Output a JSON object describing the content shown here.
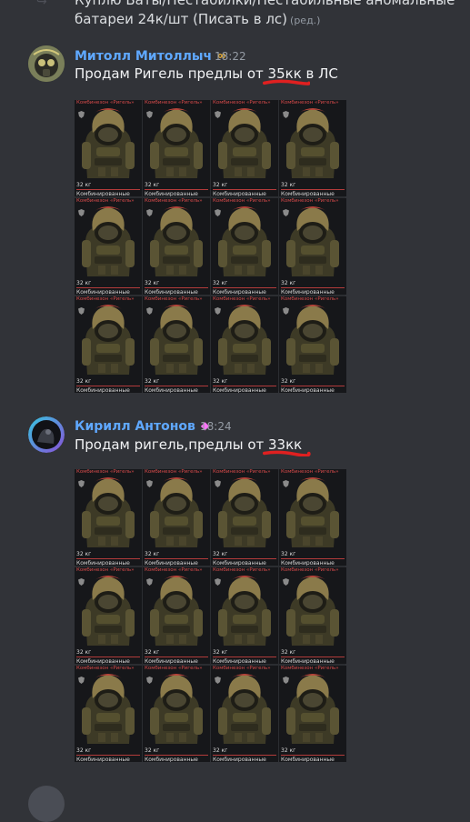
{
  "previous_message": {
    "line1": "Куплю Баты/Пестабилки/Пестабильные аномальные",
    "line2": "батареи 24к/шт (Писать в лс)",
    "edited": "(ред.)"
  },
  "messages": [
    {
      "author": "Митолл Митоллыч",
      "badge_icon": "infinity-badge-icon",
      "time": "18:22",
      "text_before": "Продам Ригель предлы от ",
      "text_highlight": "35кк",
      "text_after": " в ЛС",
      "scribble_color": "#e02020",
      "attachment": {
        "tile_count": 12,
        "tile_top_text": "Комбинезон «Ригель»",
        "tile_weight": "32 кг",
        "tile_label": "Комбинированные"
      }
    },
    {
      "author": "Кирилл Антонов",
      "badge_icon": "nitro-badge-icon",
      "time": "18:24",
      "text_before": "Продам ригель,предлы от ",
      "text_highlight": "33кк",
      "text_after": "",
      "scribble_color": "#e02020",
      "attachment": {
        "tile_count": 12,
        "tile_top_text": "Комбинезон «Ригель»",
        "tile_weight": "32 кг",
        "tile_label": "Комбинированные"
      }
    }
  ],
  "colors": {
    "background": "#313338",
    "author_name": "#5fa8ff",
    "timestamp": "#949ba4",
    "message_text": "#f2f3f5"
  }
}
